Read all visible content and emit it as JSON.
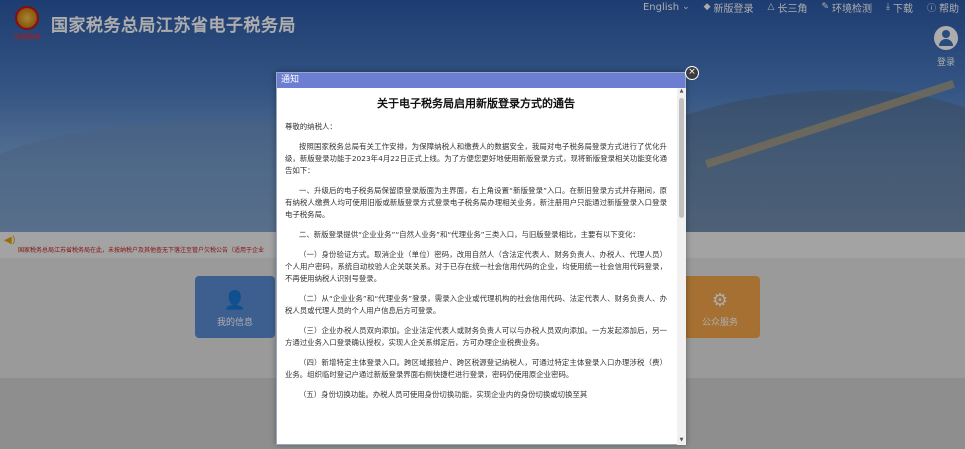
{
  "header": {
    "site_title": "国家税务总局江苏省电子税务局",
    "emblem_text": "中国税务",
    "nav": [
      {
        "label": "English",
        "icon": "chevron-down-icon"
      },
      {
        "label": "新版登录",
        "icon": "diamond-icon"
      },
      {
        "label": "长三角",
        "icon": "triangle-icon"
      },
      {
        "label": "环境检测",
        "icon": "tool-icon"
      },
      {
        "label": "下载",
        "icon": "download-icon"
      },
      {
        "label": "帮助",
        "icon": "help-icon"
      }
    ],
    "login_label": "登录"
  },
  "marquee": {
    "text": "国家税务总局江苏省税务局在此，未按纳税户及其他查无下落注至管户欠税公告（适用于企业"
  },
  "tiles": {
    "mine": "我的信息",
    "public": "公众服务"
  },
  "modal": {
    "header": "通知",
    "close": "×",
    "title": "关于电子税务局启用新版登录方式的通告",
    "paragraphs": [
      "尊敬的纳税人：",
      "按照国家税务总局有关工作安排，为保障纳税人和缴费人的数据安全，我局对电子税务局登录方式进行了优化升级，新版登录功能于2023年4月22日正式上线。为了方便您更好地使用新版登录方式，现将新版登录相关功能变化通告如下：",
      "一、升级后的电子税务局保留原登录版面为主界面，右上角设置“新版登录”入口。在新旧登录方式并存期间，原有纳税人缴费人均可使用旧版或新版登录方式登录电子税务局办理相关业务，新注册用户只能通过新版登录入口登录电子税务局。",
      "二、新版登录提供“企业业务”“自然人业务”和“代理业务”三类入口，与旧版登录相比，主要有以下变化：",
      "（一）身份验证方式。取消企业（单位）密码，改用自然人（含法定代表人、财务负责人、办税人、代理人员）个人用户密码，系统自动校验人企关联关系。对于已存在统一社会信用代码的企业，均使用统一社会信用代码登录，不再使用纳税人识别号登录。",
      "（二）从“企业业务”和“代理业务”登录，需录入企业或代理机构的社会信用代码、法定代表人、财务负责人、办税人员或代理人员的个人用户信息后方可登录。",
      "（三）企业办税人员双向添加。企业法定代表人或财务负责人可以与办税人员双向添加。一方发起添加后，另一方通过业务入口登录确认授权，实现人企关系绑定后，方可办理企业税费业务。",
      "（四）新增特定主体登录入口。跨区域报验户、跨区税源登记纳税人，可通过特定主体登录入口办理涉税（费）业务。组织临时登记户通过新版登录界面右侧快捷栏进行登录，密码仍使用原企业密码。",
      "（五）身份切换功能。办税人员可使用身份切换功能，实现企业内的身份切换或切换至其"
    ]
  }
}
